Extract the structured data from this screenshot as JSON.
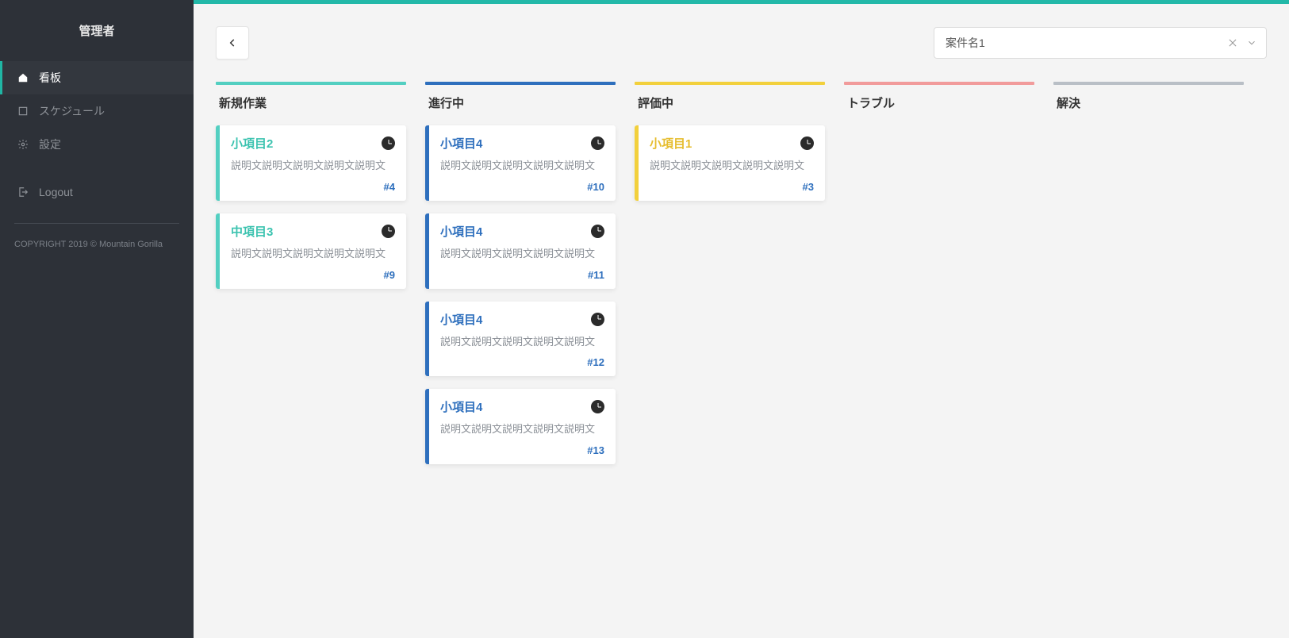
{
  "sidebar": {
    "title": "管理者",
    "items": [
      {
        "label": "看板",
        "active": true
      },
      {
        "label": "スケジュール",
        "active": false
      },
      {
        "label": "設定",
        "active": false
      },
      {
        "label": "Logout",
        "active": false
      }
    ],
    "copyright": "COPYRIGHT 2019 © Mountain Gorilla"
  },
  "topbar": {
    "project_select": {
      "value": "案件名1"
    }
  },
  "colors": {
    "col_new": "#53cfc1",
    "col_progress": "#2e6fbd",
    "col_review": "#f2d03c",
    "col_trouble": "#f19b9b",
    "col_done": "#b9bfc6"
  },
  "board": {
    "columns": [
      {
        "title": "新規作業",
        "color_key": "col_new",
        "title_color": "#3cc3b0",
        "id_color": "#2e6fbd",
        "cards": [
          {
            "title": "小項目2",
            "desc": "説明文説明文説明文説明文説明文",
            "id": "#4"
          },
          {
            "title": "中項目3",
            "desc": "説明文説明文説明文説明文説明文",
            "id": "#9"
          }
        ]
      },
      {
        "title": "進行中",
        "color_key": "col_progress",
        "title_color": "#2e6fbd",
        "id_color": "#2e6fbd",
        "cards": [
          {
            "title": "小項目4",
            "desc": "説明文説明文説明文説明文説明文",
            "id": "#10"
          },
          {
            "title": "小項目4",
            "desc": "説明文説明文説明文説明文説明文",
            "id": "#11"
          },
          {
            "title": "小項目4",
            "desc": "説明文説明文説明文説明文説明文",
            "id": "#12"
          },
          {
            "title": "小項目4",
            "desc": "説明文説明文説明文説明文説明文",
            "id": "#13"
          }
        ]
      },
      {
        "title": "評価中",
        "color_key": "col_review",
        "title_color": "#e6bd2e",
        "id_color": "#2e6fbd",
        "cards": [
          {
            "title": "小項目1",
            "desc": "説明文説明文説明文説明文説明文",
            "id": "#3"
          }
        ]
      },
      {
        "title": "トラブル",
        "color_key": "col_trouble",
        "title_color": "#f19b9b",
        "id_color": "#2e6fbd",
        "cards": []
      },
      {
        "title": "解決",
        "color_key": "col_done",
        "title_color": "#b9bfc6",
        "id_color": "#2e6fbd",
        "cards": []
      }
    ]
  }
}
